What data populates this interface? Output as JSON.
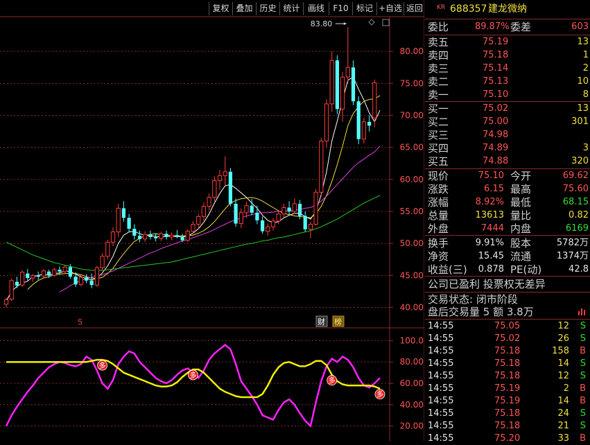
{
  "toolbar": {
    "items": [
      "复权",
      "叠加",
      "历史",
      "统计",
      "画线",
      "F10",
      "标记",
      "+自选",
      "返回"
    ]
  },
  "header": {
    "market_tag": "KR",
    "code": "688357",
    "name": "建龙微纳"
  },
  "ratio": {
    "wei_bi_label": "委比",
    "wei_bi_value": "89.87%",
    "wei_cha_label": "委差",
    "wei_cha_value": "603"
  },
  "asks": [
    {
      "label": "卖五",
      "price": "75.19",
      "volume": "13"
    },
    {
      "label": "卖四",
      "price": "75.18",
      "volume": "1"
    },
    {
      "label": "卖三",
      "price": "75.14",
      "volume": "2"
    },
    {
      "label": "卖二",
      "price": "75.13",
      "volume": "10"
    },
    {
      "label": "卖一",
      "price": "75.10",
      "volume": "8"
    }
  ],
  "bids": [
    {
      "label": "买一",
      "price": "75.02",
      "volume": "13"
    },
    {
      "label": "买二",
      "price": "75.00",
      "volume": "301"
    },
    {
      "label": "买三",
      "price": "74.98",
      "volume": ""
    },
    {
      "label": "买四",
      "price": "74.89",
      "volume": "3"
    },
    {
      "label": "买五",
      "price": "74.88",
      "volume": "320"
    }
  ],
  "quote": [
    {
      "l1": "现价",
      "v1": "75.10",
      "l2": "今开",
      "v2": "69.62",
      "c1": "red",
      "c2": "red"
    },
    {
      "l1": "涨跌",
      "v1": "6.15",
      "l2": "最高",
      "v2": "75.60",
      "c1": "red",
      "c2": "red"
    },
    {
      "l1": "涨幅",
      "v1": "8.92%",
      "l2": "最低",
      "v2": "68.15",
      "c1": "red",
      "c2": "green"
    },
    {
      "l1": "总量",
      "v1": "13613",
      "l2": "量比",
      "v2": "0.82",
      "c1": "yellow",
      "c2": "yellow"
    },
    {
      "l1": "外盘",
      "v1": "7444",
      "l2": "内盘",
      "v2": "6169",
      "c1": "red",
      "c2": "green"
    }
  ],
  "stats": [
    {
      "l1": "换手",
      "v1": "9.91%",
      "l2": "股本",
      "v2": "5782万"
    },
    {
      "l1": "净资",
      "v1": "15.45",
      "l2": "流通",
      "v2": "1374万"
    },
    {
      "l1": "收益(三)",
      "v1": "0.878",
      "l2": "PE(动)",
      "v2": "42.8"
    }
  ],
  "info": {
    "line1": "公司已盈利 投票权无差异",
    "line2": "交易状态: 闭市阶段",
    "line3": "盘后交易量 5 额 3.8万"
  },
  "trades": [
    {
      "time": "14:55",
      "price": "75.05",
      "vol": "12",
      "side": "S"
    },
    {
      "time": "14:55",
      "price": "75.02",
      "vol": "26",
      "side": "S"
    },
    {
      "time": "14:55",
      "price": "75.18",
      "vol": "158",
      "side": "B"
    },
    {
      "time": "14:55",
      "price": "75.18",
      "vol": "14",
      "side": "S"
    },
    {
      "time": "14:55",
      "price": "75.18",
      "vol": "12",
      "side": "S"
    },
    {
      "time": "14:55",
      "price": "75.19",
      "vol": "2",
      "side": "B"
    },
    {
      "time": "14:55",
      "price": "75.19",
      "vol": "14",
      "side": "B"
    },
    {
      "time": "14:55",
      "price": "75.18",
      "vol": "24",
      "side": "S"
    },
    {
      "time": "14:55",
      "price": "75.18",
      "vol": "21",
      "side": "S"
    },
    {
      "time": "14:55",
      "price": "75.20",
      "vol": "33",
      "side": "B"
    }
  ],
  "colors": {
    "up": "#ff3c3c",
    "down": "#54ffff",
    "ma_short": "#ffffff",
    "ma_mid": "#f0e040",
    "ma_long": "#e040e0",
    "ma_longest": "#22cc22",
    "grid": "#8a2a2a",
    "osc_fast": "#ff22ff",
    "osc_slow": "#f0f000"
  },
  "chart_data": [
    {
      "type": "candlestick",
      "title": "",
      "ylim": [
        38,
        85
      ],
      "yticks": [
        40.0,
        45.0,
        50.0,
        55.0,
        60.0,
        65.0,
        70.0,
        75.0,
        80.0
      ],
      "ytick_labels": [
        "40.00",
        "45.00",
        "50.00",
        "55.00",
        "60.00",
        "65.00",
        "70.00",
        "75.00",
        "80.00"
      ],
      "max_label": "83.80",
      "markers": [
        "S",
        "财",
        "榜"
      ],
      "candles": [
        {
          "o": 40.5,
          "h": 41.5,
          "l": 40.0,
          "c": 41.2
        },
        {
          "o": 41.3,
          "h": 44.5,
          "l": 41.0,
          "c": 44.2
        },
        {
          "o": 44.0,
          "h": 44.8,
          "l": 43.0,
          "c": 43.4
        },
        {
          "o": 43.5,
          "h": 45.8,
          "l": 43.2,
          "c": 45.5
        },
        {
          "o": 45.3,
          "h": 46.0,
          "l": 44.2,
          "c": 44.6
        },
        {
          "o": 44.6,
          "h": 45.2,
          "l": 44.0,
          "c": 45.0
        },
        {
          "o": 45.0,
          "h": 45.6,
          "l": 44.3,
          "c": 44.8
        },
        {
          "o": 44.9,
          "h": 46.0,
          "l": 44.6,
          "c": 45.7
        },
        {
          "o": 45.6,
          "h": 45.9,
          "l": 44.6,
          "c": 45.0
        },
        {
          "o": 45.0,
          "h": 46.2,
          "l": 44.8,
          "c": 45.9
        },
        {
          "o": 45.9,
          "h": 46.4,
          "l": 45.2,
          "c": 45.6
        },
        {
          "o": 45.6,
          "h": 46.6,
          "l": 45.3,
          "c": 46.3
        },
        {
          "o": 46.3,
          "h": 46.8,
          "l": 44.5,
          "c": 44.8
        },
        {
          "o": 44.8,
          "h": 45.5,
          "l": 43.2,
          "c": 43.6
        },
        {
          "o": 43.6,
          "h": 45.0,
          "l": 43.3,
          "c": 44.7
        },
        {
          "o": 44.7,
          "h": 45.2,
          "l": 43.8,
          "c": 44.2
        },
        {
          "o": 44.2,
          "h": 45.3,
          "l": 43.0,
          "c": 43.5
        },
        {
          "o": 43.5,
          "h": 46.5,
          "l": 43.2,
          "c": 46.2
        },
        {
          "o": 46.2,
          "h": 48.5,
          "l": 45.8,
          "c": 48.0
        },
        {
          "o": 48.0,
          "h": 50.6,
          "l": 47.5,
          "c": 50.2
        },
        {
          "o": 50.2,
          "h": 52.5,
          "l": 49.6,
          "c": 51.8
        },
        {
          "o": 51.8,
          "h": 56.2,
          "l": 51.0,
          "c": 55.5
        },
        {
          "o": 55.5,
          "h": 56.6,
          "l": 53.4,
          "c": 54.0
        },
        {
          "o": 54.0,
          "h": 54.6,
          "l": 51.8,
          "c": 52.3
        },
        {
          "o": 52.3,
          "h": 53.0,
          "l": 50.6,
          "c": 51.2
        },
        {
          "o": 51.2,
          "h": 52.0,
          "l": 50.2,
          "c": 50.7
        },
        {
          "o": 50.7,
          "h": 51.9,
          "l": 50.2,
          "c": 51.4
        },
        {
          "o": 51.4,
          "h": 52.0,
          "l": 50.6,
          "c": 51.0
        },
        {
          "o": 51.0,
          "h": 51.6,
          "l": 50.3,
          "c": 50.8
        },
        {
          "o": 50.8,
          "h": 51.8,
          "l": 50.4,
          "c": 51.5
        },
        {
          "o": 51.5,
          "h": 52.0,
          "l": 50.6,
          "c": 51.0
        },
        {
          "o": 51.0,
          "h": 51.7,
          "l": 50.5,
          "c": 51.3
        },
        {
          "o": 51.3,
          "h": 52.1,
          "l": 50.8,
          "c": 51.0
        },
        {
          "o": 51.0,
          "h": 51.5,
          "l": 50.2,
          "c": 50.5
        },
        {
          "o": 50.5,
          "h": 52.2,
          "l": 50.2,
          "c": 51.9
        },
        {
          "o": 51.9,
          "h": 53.5,
          "l": 51.5,
          "c": 53.0
        },
        {
          "o": 53.0,
          "h": 54.6,
          "l": 52.3,
          "c": 54.2
        },
        {
          "o": 54.2,
          "h": 56.4,
          "l": 53.6,
          "c": 55.8
        },
        {
          "o": 55.8,
          "h": 57.8,
          "l": 55.2,
          "c": 57.2
        },
        {
          "o": 57.2,
          "h": 60.5,
          "l": 56.5,
          "c": 59.8
        },
        {
          "o": 59.8,
          "h": 61.5,
          "l": 58.4,
          "c": 60.6
        },
        {
          "o": 60.6,
          "h": 63.6,
          "l": 59.0,
          "c": 61.2
        },
        {
          "o": 61.2,
          "h": 61.8,
          "l": 55.8,
          "c": 56.2
        },
        {
          "o": 56.2,
          "h": 57.0,
          "l": 52.6,
          "c": 53.1
        },
        {
          "o": 53.1,
          "h": 55.5,
          "l": 52.4,
          "c": 54.8
        },
        {
          "o": 54.8,
          "h": 56.5,
          "l": 54.0,
          "c": 55.9
        },
        {
          "o": 55.9,
          "h": 57.0,
          "l": 54.4,
          "c": 54.8
        },
        {
          "o": 54.8,
          "h": 55.9,
          "l": 53.0,
          "c": 53.6
        },
        {
          "o": 53.6,
          "h": 54.2,
          "l": 51.5,
          "c": 51.9
        },
        {
          "o": 51.9,
          "h": 53.1,
          "l": 51.2,
          "c": 52.6
        },
        {
          "o": 52.6,
          "h": 54.0,
          "l": 52.0,
          "c": 53.5
        },
        {
          "o": 53.5,
          "h": 55.2,
          "l": 53.0,
          "c": 54.6
        },
        {
          "o": 54.6,
          "h": 56.2,
          "l": 54.0,
          "c": 55.6
        },
        {
          "o": 55.6,
          "h": 56.6,
          "l": 54.4,
          "c": 55.0
        },
        {
          "o": 55.0,
          "h": 57.0,
          "l": 54.6,
          "c": 56.2
        },
        {
          "o": 56.2,
          "h": 56.8,
          "l": 53.8,
          "c": 54.3
        },
        {
          "o": 54.3,
          "h": 55.0,
          "l": 51.8,
          "c": 52.2
        },
        {
          "o": 52.2,
          "h": 53.4,
          "l": 50.8,
          "c": 53.0
        },
        {
          "o": 53.0,
          "h": 58.5,
          "l": 52.8,
          "c": 58.0
        },
        {
          "o": 58.0,
          "h": 66.5,
          "l": 57.6,
          "c": 66.0
        },
        {
          "o": 66.0,
          "h": 72.5,
          "l": 65.0,
          "c": 71.8
        },
        {
          "o": 71.8,
          "h": 80.0,
          "l": 70.6,
          "c": 78.6
        },
        {
          "o": 78.6,
          "h": 79.4,
          "l": 70.2,
          "c": 71.0
        },
        {
          "o": 71.0,
          "h": 76.8,
          "l": 69.0,
          "c": 76.0
        },
        {
          "o": 76.0,
          "h": 83.8,
          "l": 75.0,
          "c": 77.5
        },
        {
          "o": 77.5,
          "h": 78.6,
          "l": 71.6,
          "c": 72.2
        },
        {
          "o": 72.2,
          "h": 73.0,
          "l": 65.5,
          "c": 66.3
        },
        {
          "o": 66.3,
          "h": 69.6,
          "l": 65.6,
          "c": 69.0
        },
        {
          "o": 69.0,
          "h": 70.0,
          "l": 67.5,
          "c": 68.4
        },
        {
          "o": 69.62,
          "h": 75.6,
          "l": 68.15,
          "c": 75.1
        }
      ],
      "series": [
        {
          "values": [
            41.0,
            42.5,
            43.3,
            43.8,
            44.1,
            44.8,
            45.0,
            45.2,
            45.0,
            45.3,
            45.4,
            45.7,
            45.6,
            45.2,
            44.8,
            44.5,
            44.3,
            44.6,
            45.4,
            46.5,
            48.0,
            50.0,
            51.3,
            51.8,
            51.9,
            51.5,
            51.3,
            51.2,
            51.1,
            51.0,
            51.1,
            51.1,
            51.1,
            51.0,
            51.2,
            51.6,
            52.3,
            53.3,
            54.6,
            56.3,
            57.8,
            59.0,
            59.2,
            58.6,
            57.9,
            57.2,
            56.3,
            55.5,
            54.4,
            53.6,
            53.2,
            53.4,
            54.0,
            54.4,
            54.7,
            54.7,
            54.2,
            53.8,
            55.0,
            57.6,
            61.2,
            66.0,
            69.1,
            72.4,
            75.5,
            76.0,
            74.1,
            72.4,
            70.4,
            69.0,
            70.8
          ]
        },
        {
          "values": [
            null,
            null,
            null,
            null,
            42.8,
            43.6,
            44.2,
            44.6,
            44.8,
            45.1,
            45.2,
            45.3,
            45.3,
            45.3,
            45.1,
            44.8,
            44.6,
            44.5,
            44.7,
            45.3,
            46.1,
            47.3,
            48.4,
            49.4,
            50.3,
            50.8,
            51.2,
            51.4,
            51.5,
            51.4,
            51.3,
            51.2,
            51.2,
            51.2,
            51.2,
            51.3,
            51.6,
            52.0,
            52.6,
            53.4,
            54.4,
            55.4,
            56.3,
            56.7,
            57.0,
            57.1,
            57.2,
            57.0,
            56.6,
            56.1,
            55.6,
            55.1,
            54.7,
            54.5,
            54.3,
            54.2,
            54.1,
            54.0,
            54.6,
            55.8,
            57.5,
            59.7,
            62.3,
            65.2,
            68.4,
            70.3,
            71.4,
            72.2,
            72.5,
            72.6,
            73.1
          ]
        },
        {
          "values": [
            null,
            null,
            null,
            null,
            null,
            null,
            null,
            null,
            null,
            null,
            42.4,
            42.9,
            43.4,
            43.8,
            44.2,
            44.5,
            44.7,
            44.9,
            45.1,
            45.4,
            45.7,
            46.1,
            46.5,
            46.9,
            47.3,
            47.7,
            48.1,
            48.5,
            48.8,
            49.2,
            49.5,
            49.8,
            50.1,
            50.4,
            50.6,
            50.9,
            51.2,
            51.5,
            51.8,
            52.2,
            52.6,
            53.0,
            53.4,
            53.7,
            54.0,
            54.3,
            54.5,
            54.7,
            54.8,
            54.8,
            54.9,
            55.0,
            55.0,
            55.1,
            55.2,
            55.3,
            55.5,
            55.6,
            56.0,
            56.6,
            57.4,
            58.3,
            59.2,
            60.1,
            61.0,
            61.9,
            62.6,
            63.2,
            63.8,
            64.3,
            65.2
          ]
        },
        {
          "values": [
            50.2,
            49.8,
            49.4,
            49.0,
            48.6,
            48.2,
            47.9,
            47.6,
            47.3,
            47.0,
            46.8,
            46.6,
            46.4,
            46.2,
            46.0,
            45.9,
            45.8,
            45.8,
            45.8,
            45.9,
            46.0,
            46.1,
            46.2,
            46.3,
            46.4,
            46.5,
            46.6,
            46.7,
            46.8,
            46.9,
            47.0,
            47.1,
            47.3,
            47.5,
            47.7,
            47.9,
            48.1,
            48.3,
            48.5,
            48.7,
            48.9,
            49.1,
            49.3,
            49.5,
            49.7,
            49.9,
            50.0,
            50.2,
            50.4,
            50.5,
            50.7,
            50.9,
            51.0,
            51.2,
            51.4,
            51.6,
            51.8,
            52.0,
            52.3,
            52.6,
            53.0,
            53.4,
            53.8,
            54.3,
            54.8,
            55.3,
            55.8,
            56.3,
            56.7,
            57.1,
            57.5
          ]
        }
      ]
    },
    {
      "type": "line",
      "title": "",
      "ylim": [
        10,
        110
      ],
      "yticks": [
        20.0,
        40.0,
        60.0,
        80.0,
        100.0
      ],
      "ytick_labels": [
        "20.00",
        "40.00",
        "60.00",
        "80.00",
        "100.0"
      ],
      "markers": [
        "多",
        "多",
        "多",
        "多"
      ],
      "series": [
        {
          "values": [
            20,
            30,
            38,
            45,
            52,
            58,
            65,
            70,
            75,
            78,
            80,
            79,
            77,
            76,
            78,
            85,
            82,
            72,
            60,
            55,
            63,
            78,
            85,
            90,
            88,
            80,
            75,
            70,
            65,
            62,
            60,
            63,
            68,
            72,
            74,
            70,
            65,
            72,
            82,
            88,
            92,
            96,
            92,
            78,
            62,
            55,
            48,
            40,
            30,
            28,
            26,
            35,
            42,
            45,
            40,
            32,
            25,
            20,
            42,
            62,
            76,
            83,
            80,
            85,
            82,
            75,
            65,
            58,
            56,
            60,
            65
          ]
        },
        {
          "values": [
            80,
            80,
            80,
            80,
            80,
            80,
            80,
            80,
            80,
            80,
            80,
            80,
            80,
            80,
            80,
            80,
            81,
            82,
            82,
            81,
            78,
            74,
            70,
            68,
            66,
            64,
            62,
            60,
            58,
            57,
            57,
            58,
            61,
            66,
            70,
            73,
            73,
            70,
            65,
            60,
            55,
            52,
            50,
            48,
            47,
            47,
            47,
            47,
            50,
            58,
            68,
            75,
            79,
            80,
            78,
            76,
            76,
            78,
            81,
            81,
            77,
            68,
            62,
            59,
            58,
            58,
            58,
            58,
            58,
            57,
            55
          ]
        }
      ]
    }
  ]
}
